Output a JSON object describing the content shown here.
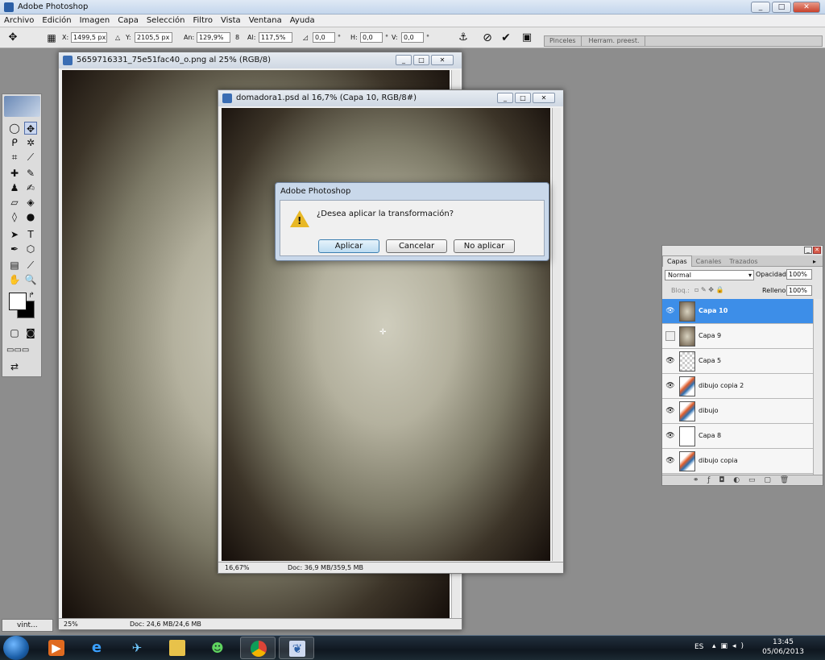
{
  "app": {
    "title": "Adobe Photoshop"
  },
  "window_controls": {
    "minimize": "_",
    "maximize": "□",
    "close": "✕"
  },
  "menu": [
    "Archivo",
    "Edición",
    "Imagen",
    "Capa",
    "Selección",
    "Filtro",
    "Vista",
    "Ventana",
    "Ayuda"
  ],
  "options": {
    "x_label": "X:",
    "x_value": "1499,5 px",
    "y_label": "Y:",
    "y_value": "2105,5 px",
    "w_label": "An:",
    "w_value": "129,9%",
    "h_label": "Al:",
    "h_value": "117,5%",
    "angle_value": "0,0",
    "deg": "°",
    "hskew_label": "H:",
    "hskew_value": "0,0",
    "vskew_label": "V:",
    "vskew_value": "0,0",
    "wells": [
      "Pinceles",
      "Herram. preest."
    ]
  },
  "doc1": {
    "title": "5659716331_75e51fac40_o.png al 25% (RGB/8)",
    "zoom": "25%",
    "doc": "Doc: 24,6 MB/24,6 MB"
  },
  "doc2": {
    "title": "domadora1.psd al 16,7% (Capa 10, RGB/8#)",
    "zoom": "16,67%",
    "doc": "Doc: 36,9 MB/359,5 MB"
  },
  "dialog": {
    "title": "Adobe Photoshop",
    "message": "¿Desea aplicar la transformación?",
    "buttons": {
      "apply": "Aplicar",
      "cancel": "Cancelar",
      "dont_apply": "No aplicar"
    }
  },
  "layers_panel": {
    "tabs": [
      "Capas",
      "Canales",
      "Trazados"
    ],
    "blend_mode": "Normal",
    "opacity_label": "Opacidad:",
    "opacity_value": "100%",
    "lock_label": "Bloq.:",
    "fill_label": "Relleno:",
    "fill_value": "100%",
    "layers": [
      {
        "name": "Capa 10",
        "visible": true,
        "selected": true
      },
      {
        "name": "Capa 9",
        "visible": false
      },
      {
        "name": "Capa 5",
        "visible": true
      },
      {
        "name": "dibujo copia 2",
        "visible": true
      },
      {
        "name": "dibujo",
        "visible": true
      },
      {
        "name": "Capa 8",
        "visible": true
      },
      {
        "name": "dibujo copia",
        "visible": true
      }
    ]
  },
  "minimized_doc": {
    "label": "vint..."
  },
  "taskbar": {
    "language": "ES",
    "time": "13:45",
    "date": "05/06/2013"
  },
  "colors": {
    "accent": "#3d8ee8",
    "warning": "#e8b826"
  }
}
